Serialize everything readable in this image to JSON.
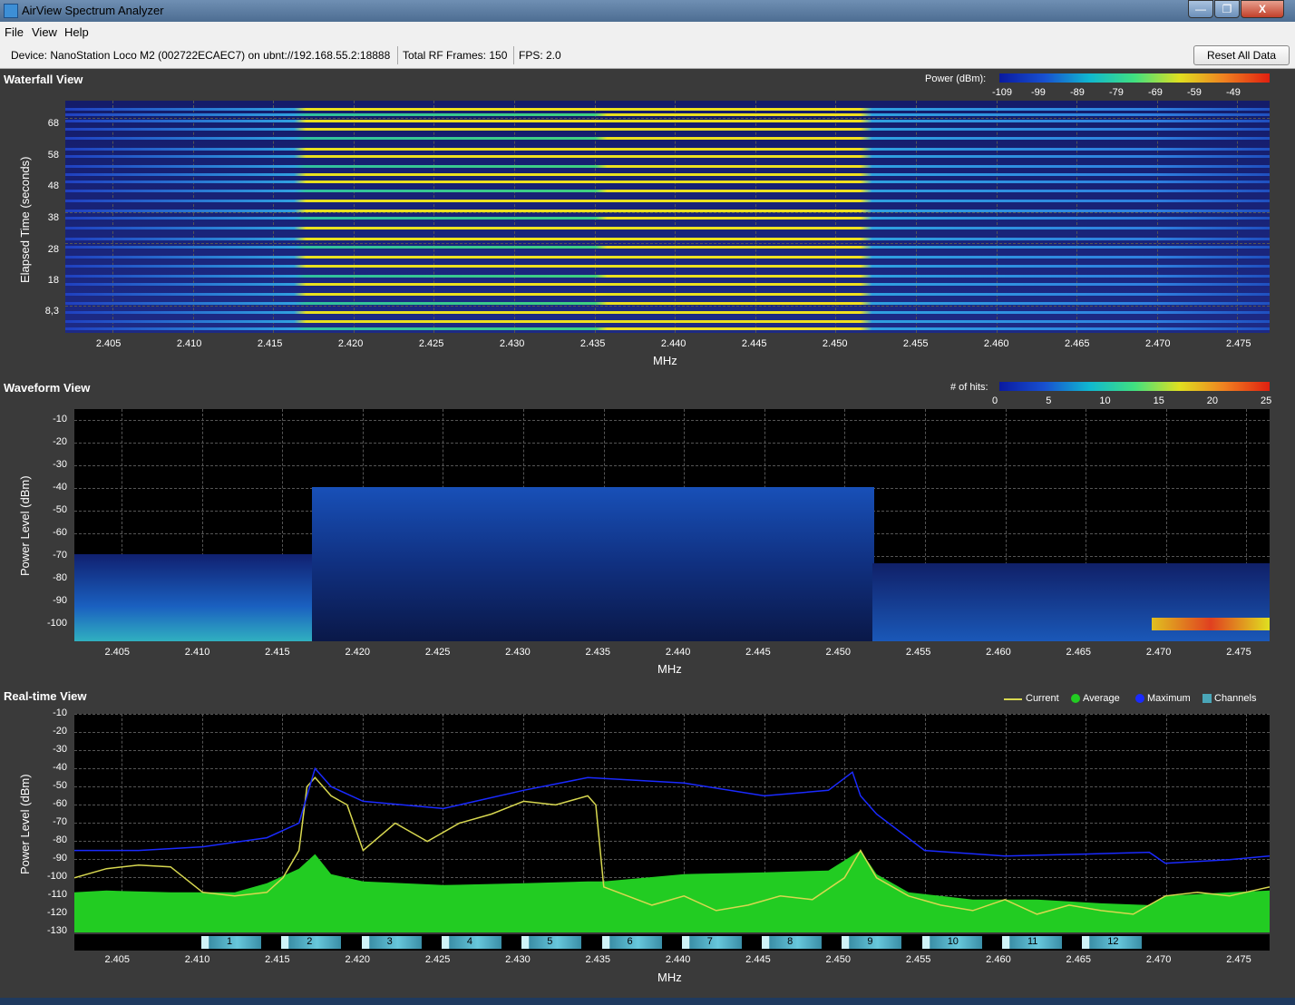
{
  "window": {
    "title": "AirView Spectrum Analyzer",
    "min": "—",
    "max": "❐",
    "close": "X"
  },
  "menu": [
    "File",
    "View",
    "Help"
  ],
  "device_bar": {
    "device": "Device: NanoStation Loco M2 (002722ECAEC7) on ubnt://192.168.55.2:18888",
    "frames": "Total RF Frames: 150",
    "fps": "FPS: 2.0",
    "reset_label": "Reset All Data"
  },
  "waterfall": {
    "title": "Waterfall View",
    "legend_title": "Power (dBm):",
    "legend_ticks": [
      "-109",
      "-99",
      "-89",
      "-79",
      "-69",
      "-59",
      "-49"
    ],
    "y_title": "Elapsed Time (seconds)",
    "y_ticks": [
      "68",
      "58",
      "48",
      "38",
      "28",
      "18",
      "8,3"
    ],
    "x_ticks": [
      "2.405",
      "2.410",
      "2.415",
      "2.420",
      "2.425",
      "2.430",
      "2.435",
      "2.440",
      "2.445",
      "2.450",
      "2.455",
      "2.460",
      "2.465",
      "2.470",
      "2.475"
    ],
    "x_title": "MHz"
  },
  "waveform": {
    "title": "Waveform View",
    "legend_title": "# of hits:",
    "legend_ticks": [
      "0",
      "5",
      "10",
      "15",
      "20",
      "25"
    ],
    "y_title": "Power Level (dBm)",
    "y_ticks": [
      "-10",
      "-20",
      "-30",
      "-40",
      "-50",
      "-60",
      "-70",
      "-80",
      "-90",
      "-100"
    ],
    "x_ticks": [
      "2.405",
      "2.410",
      "2.415",
      "2.420",
      "2.425",
      "2.430",
      "2.435",
      "2.440",
      "2.445",
      "2.450",
      "2.455",
      "2.460",
      "2.465",
      "2.470",
      "2.475"
    ],
    "x_title": "MHz"
  },
  "realtime": {
    "title": "Real-time View",
    "legend": [
      {
        "label": "Current",
        "color": "#d8d850"
      },
      {
        "label": "Average",
        "color": "#22cc22"
      },
      {
        "label": "Maximum",
        "color": "#1a2aff"
      },
      {
        "label": "Channels",
        "color": "#4aa6b8"
      }
    ],
    "y_title": "Power Level (dBm)",
    "y_ticks": [
      "-10",
      "-20",
      "-30",
      "-40",
      "-50",
      "-60",
      "-70",
      "-80",
      "-90",
      "-100",
      "-110",
      "-120",
      "-130"
    ],
    "x_ticks": [
      "2.405",
      "2.410",
      "2.415",
      "2.420",
      "2.425",
      "2.430",
      "2.435",
      "2.440",
      "2.445",
      "2.450",
      "2.455",
      "2.460",
      "2.465",
      "2.470",
      "2.475"
    ],
    "x_title": "MHz",
    "channels": [
      "1",
      "2",
      "3",
      "4",
      "5",
      "6",
      "7",
      "8",
      "9",
      "10",
      "11",
      "12"
    ]
  },
  "chart_data": {
    "type": "line",
    "x_range": [
      2.402,
      2.4765
    ],
    "ylim": [
      -130,
      -10
    ],
    "series": [
      {
        "name": "Current",
        "x": [
          2.402,
          2.404,
          2.406,
          2.408,
          2.41,
          2.412,
          2.414,
          2.415,
          2.416,
          2.4165,
          2.417,
          2.418,
          2.419,
          2.42,
          2.422,
          2.424,
          2.426,
          2.428,
          2.43,
          2.432,
          2.434,
          2.4345,
          2.435,
          2.438,
          2.44,
          2.442,
          2.444,
          2.446,
          2.448,
          2.45,
          2.451,
          2.452,
          2.454,
          2.456,
          2.458,
          2.46,
          2.462,
          2.464,
          2.466,
          2.468,
          2.47,
          2.472,
          2.474,
          2.4765
        ],
        "values": [
          -100,
          -95,
          -93,
          -94,
          -108,
          -110,
          -108,
          -100,
          -85,
          -50,
          -45,
          -55,
          -60,
          -85,
          -70,
          -80,
          -70,
          -65,
          -58,
          -60,
          -55,
          -60,
          -105,
          -115,
          -110,
          -118,
          -115,
          -110,
          -112,
          -100,
          -85,
          -100,
          -110,
          -115,
          -118,
          -112,
          -120,
          -115,
          -118,
          -120,
          -110,
          -108,
          -110,
          -105
        ]
      },
      {
        "name": "Average",
        "x": [
          2.402,
          2.404,
          2.408,
          2.412,
          2.414,
          2.416,
          2.417,
          2.418,
          2.42,
          2.425,
          2.43,
          2.434,
          2.435,
          2.44,
          2.445,
          2.449,
          2.451,
          2.452,
          2.454,
          2.458,
          2.462,
          2.466,
          2.469,
          2.47,
          2.474,
          2.4765
        ],
        "values": [
          -108,
          -107,
          -108,
          -108,
          -103,
          -95,
          -87,
          -98,
          -102,
          -104,
          -103,
          -102,
          -102,
          -98,
          -97,
          -96,
          -85,
          -98,
          -108,
          -112,
          -112,
          -114,
          -115,
          -110,
          -108,
          -107
        ]
      },
      {
        "name": "Maximum",
        "x": [
          2.402,
          2.406,
          2.41,
          2.414,
          2.416,
          2.417,
          2.418,
          2.42,
          2.425,
          2.43,
          2.434,
          2.44,
          2.445,
          2.449,
          2.4505,
          2.451,
          2.452,
          2.455,
          2.46,
          2.465,
          2.469,
          2.47,
          2.474,
          2.4765
        ],
        "values": [
          -85,
          -85,
          -83,
          -78,
          -70,
          -40,
          -50,
          -58,
          -62,
          -52,
          -45,
          -48,
          -55,
          -52,
          -42,
          -55,
          -65,
          -85,
          -88,
          -87,
          -86,
          -92,
          -90,
          -88
        ]
      }
    ]
  }
}
